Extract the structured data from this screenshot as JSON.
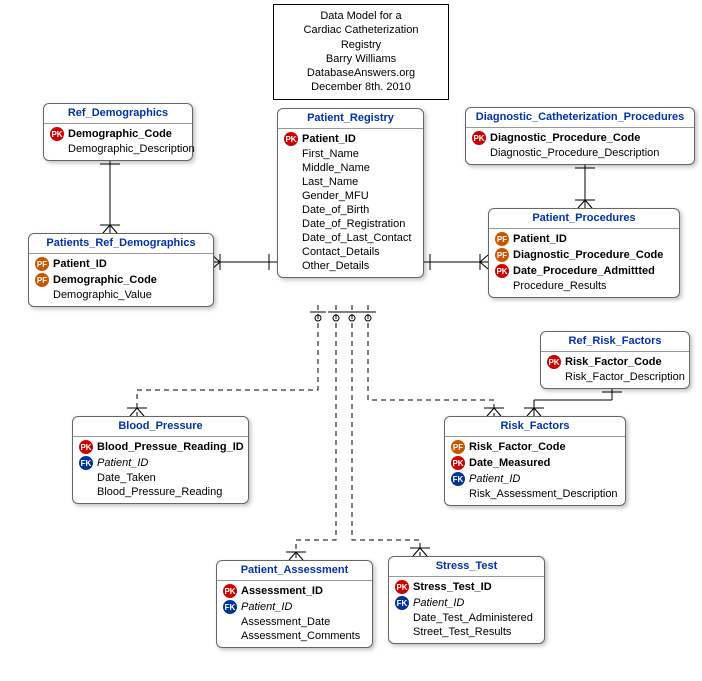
{
  "title": {
    "line1": "Data Model for a",
    "line2": "Cardiac Catheterization Registry",
    "line3": "Barry Williams",
    "line4": "DatabaseAnswers.org",
    "line5": "December 8th. 2010"
  },
  "entities": {
    "ref_demographics": {
      "name": "Ref_Demographics",
      "attrs": [
        {
          "key": "PK",
          "label": "Demographic_Code",
          "bold": true
        },
        {
          "key": "",
          "label": "Demographic_Description"
        }
      ]
    },
    "patients_ref_demographics": {
      "name": "Patients_Ref_Demographics",
      "attrs": [
        {
          "key": "PF",
          "label": "Patient_ID",
          "bold": true
        },
        {
          "key": "PF",
          "label": "Demographic_Code",
          "bold": true
        },
        {
          "key": "",
          "label": "Demographic_Value"
        }
      ]
    },
    "patient_registry": {
      "name": "Patient_Registry",
      "attrs": [
        {
          "key": "PK",
          "label": "Patient_ID",
          "bold": true
        },
        {
          "key": "",
          "label": "First_Name"
        },
        {
          "key": "",
          "label": "Middle_Name"
        },
        {
          "key": "",
          "label": "Last_Name"
        },
        {
          "key": "",
          "label": "Gender_MFU"
        },
        {
          "key": "",
          "label": "Date_of_Birth"
        },
        {
          "key": "",
          "label": "Date_of_Registration"
        },
        {
          "key": "",
          "label": "Date_of_Last_Contact"
        },
        {
          "key": "",
          "label": "Contact_Details"
        },
        {
          "key": "",
          "label": "Other_Details"
        }
      ]
    },
    "diagnostic_catheterization_procedures": {
      "name": "Diagnostic_Catheterization_Procedures",
      "attrs": [
        {
          "key": "PK",
          "label": "Diagnostic_Procedure_Code",
          "bold": true
        },
        {
          "key": "",
          "label": "Diagnostic_Procedure_Description"
        }
      ]
    },
    "patient_procedures": {
      "name": "Patient_Procedures",
      "attrs": [
        {
          "key": "PF",
          "label": "Patient_ID",
          "bold": true
        },
        {
          "key": "PF",
          "label": "Diagnostic_Procedure_Code",
          "bold": true
        },
        {
          "key": "PK",
          "label": "Date_Procedure_Admittted",
          "bold": true
        },
        {
          "key": "",
          "label": "Procedure_Results"
        }
      ]
    },
    "ref_risk_factors": {
      "name": "Ref_Risk_Factors",
      "attrs": [
        {
          "key": "PK",
          "label": "Risk_Factor_Code",
          "bold": true
        },
        {
          "key": "",
          "label": "Risk_Factor_Description"
        }
      ]
    },
    "blood_pressure": {
      "name": "Blood_Pressure",
      "attrs": [
        {
          "key": "PK",
          "label": "Blood_Pressue_Reading_ID",
          "bold": true
        },
        {
          "key": "FK",
          "label": "Patient_ID",
          "italic": true
        },
        {
          "key": "",
          "label": "Date_Taken"
        },
        {
          "key": "",
          "label": "Blood_Pressure_Reading"
        }
      ]
    },
    "risk_factors": {
      "name": "Risk_Factors",
      "attrs": [
        {
          "key": "PF",
          "label": "Risk_Factor_Code",
          "bold": true
        },
        {
          "key": "PK",
          "label": "Date_Measured",
          "bold": true
        },
        {
          "key": "FK",
          "label": "Patient_ID",
          "italic": true
        },
        {
          "key": "",
          "label": "Risk_Assessment_Description"
        }
      ]
    },
    "patient_assessment": {
      "name": "Patient_Assessment",
      "attrs": [
        {
          "key": "PK",
          "label": "Assessment_ID",
          "bold": true
        },
        {
          "key": "FK",
          "label": "Patient_ID",
          "italic": true
        },
        {
          "key": "",
          "label": "Assessment_Date"
        },
        {
          "key": "",
          "label": "Assessment_Comments"
        }
      ]
    },
    "stress_test": {
      "name": "Stress_Test",
      "attrs": [
        {
          "key": "PK",
          "label": "Stress_Test_ID",
          "bold": true
        },
        {
          "key": "FK",
          "label": "Patient_ID",
          "italic": true
        },
        {
          "key": "",
          "label": "Date_Test_Administered"
        },
        {
          "key": "",
          "label": "Street_Test_Results"
        }
      ]
    }
  },
  "key_labels": {
    "PK": "PK",
    "FK": "FK",
    "PF": "PF"
  }
}
